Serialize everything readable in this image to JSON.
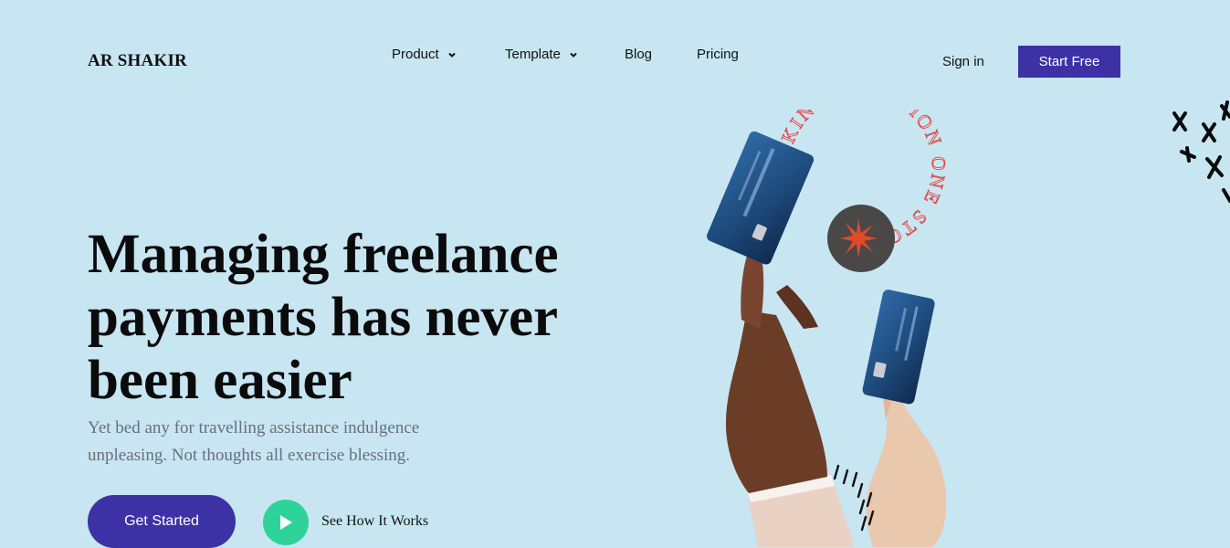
{
  "brand": {
    "logo": "AR SHAKIR"
  },
  "nav": {
    "items": [
      {
        "label": "Product",
        "has_dropdown": true
      },
      {
        "label": "Template",
        "has_dropdown": true
      },
      {
        "label": "Blog",
        "has_dropdown": false
      },
      {
        "label": "Pricing",
        "has_dropdown": false
      }
    ],
    "signin": "Sign in",
    "start_free": "Start Free"
  },
  "hero": {
    "title": "Managing freelance payments has never been easier",
    "subtitle": "Yet bed any for travelling assistance indulgence unpleasing. Not thoughts all exercise blessing.",
    "cta_primary": "Get Started",
    "cta_secondary": "See How It Works"
  },
  "badge": {
    "ring_text": "BANKING SOLUTION ONE STOP "
  },
  "colors": {
    "background": "#c7e6f1",
    "primary": "#3c32a5",
    "accent": "#2ed39a",
    "badge_text": "#e25a5a"
  },
  "icons": [
    "chevron-down-icon",
    "play-icon",
    "star-icon",
    "card-illustration",
    "scribble-decoration"
  ]
}
